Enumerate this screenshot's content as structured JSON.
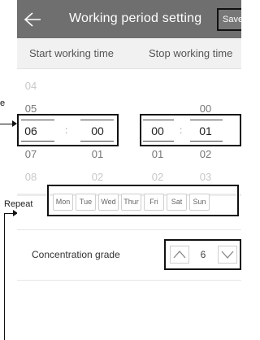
{
  "header": {
    "title": "Working period setting",
    "save_label": "Save",
    "back_icon": "back-arrow-icon"
  },
  "columns": {
    "start": "Start working time",
    "stop": "Stop working time"
  },
  "start_picker": {
    "hours": [
      "04",
      "05",
      "06",
      "07",
      "08"
    ],
    "minutes": [
      "00",
      "01",
      "02"
    ],
    "selected_hour": "06",
    "selected_minute": "00"
  },
  "stop_picker": {
    "hours": [
      "00",
      "01",
      "02"
    ],
    "minutes": [
      "00",
      "01",
      "02",
      "03"
    ],
    "selected_hour": "00",
    "selected_minute": "01"
  },
  "separator": ":",
  "repeat": {
    "label": "Repeat",
    "days": [
      "Mon",
      "Tue",
      "Wed",
      "Thur",
      "Fri",
      "Sat",
      "Sun"
    ]
  },
  "concentration": {
    "label": "Concentration grade",
    "value": "6",
    "up_icon": "chevron-up-icon",
    "down_icon": "chevron-down-icon"
  },
  "callout": {
    "side_label": "e"
  }
}
